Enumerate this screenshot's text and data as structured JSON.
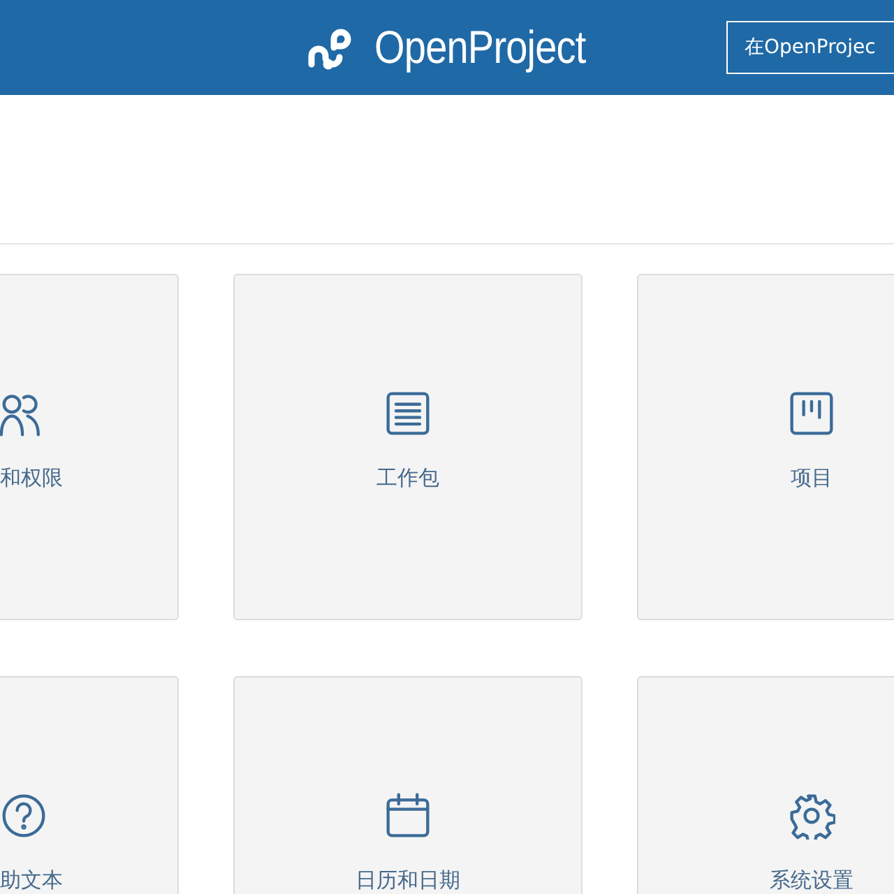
{
  "header": {
    "logo_text": "OpenProject",
    "button": "在OpenProjec"
  },
  "cards": [
    {
      "kind": "users",
      "label": "和权限",
      "clipped": true
    },
    {
      "kind": "list",
      "label": "工作包",
      "clipped": false
    },
    {
      "kind": "board",
      "label": "项目",
      "clipped": false
    },
    {
      "kind": "help",
      "label": "助文本",
      "clipped": true
    },
    {
      "kind": "calendar",
      "label": "日历和日期",
      "clipped": false
    },
    {
      "kind": "gear",
      "label": "系统设置",
      "clipped": false
    }
  ]
}
